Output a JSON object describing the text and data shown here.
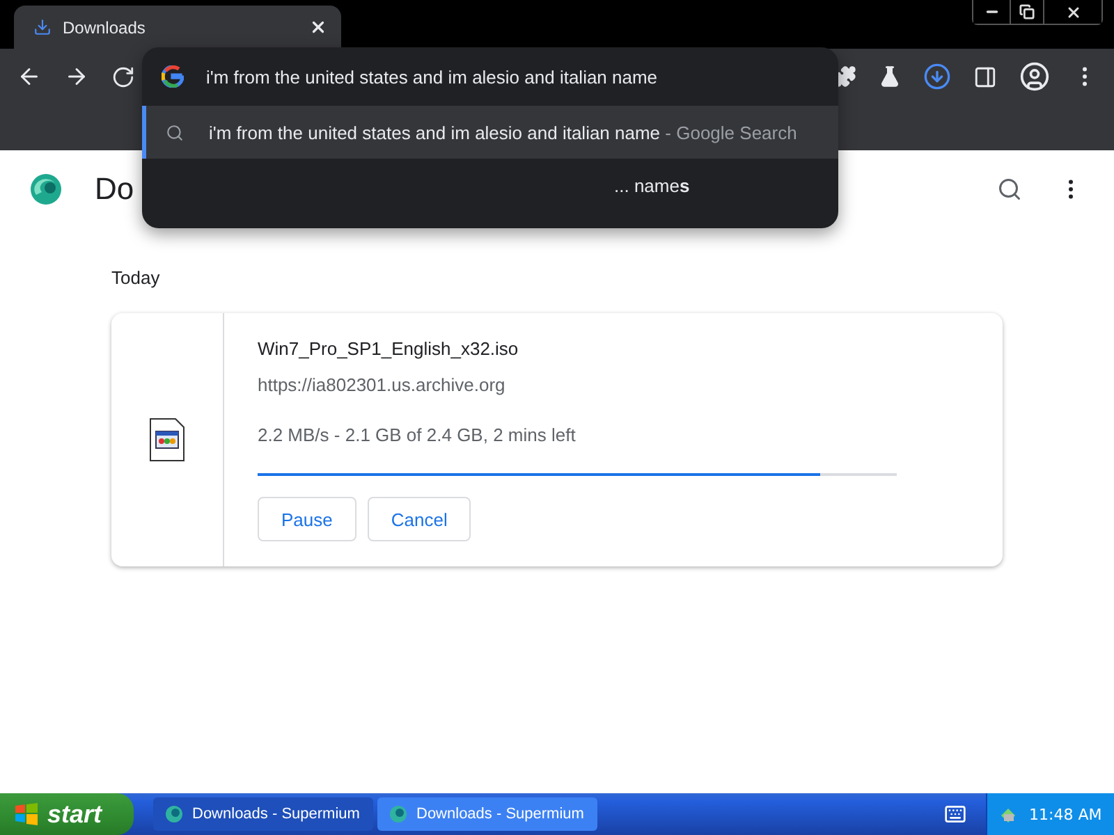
{
  "browser_tab": {
    "title": "Downloads",
    "selected": true
  },
  "omnibox": {
    "value": "i'm from the united states and im alesio and italian name",
    "suggestions": [
      {
        "kind": "search",
        "text": "i'm from the united states and im alesio and italian name",
        "hint": "- Google Search",
        "selected": true
      },
      {
        "kind": "plain",
        "text": "... name**s**",
        "selected": false
      }
    ]
  },
  "page": {
    "title": "Do",
    "section": "Today",
    "downloads": [
      {
        "filename": "Win7_Pro_SP1_English_x32.iso",
        "url": "https://ia802301.us.archive.org",
        "status": "2.2 MB/s - 2.1 GB of 2.4 GB, 2 mins left",
        "level": 0.88,
        "buttons": [
          "Pause",
          "Cancel"
        ]
      }
    ]
  },
  "taskbar": {
    "start": "start",
    "tasks": [
      {
        "label": "Downloads - Supermium",
        "selected": true
      },
      {
        "label": "Downloads - Supermium",
        "selected": false
      }
    ],
    "clock": "11:48 AM"
  }
}
